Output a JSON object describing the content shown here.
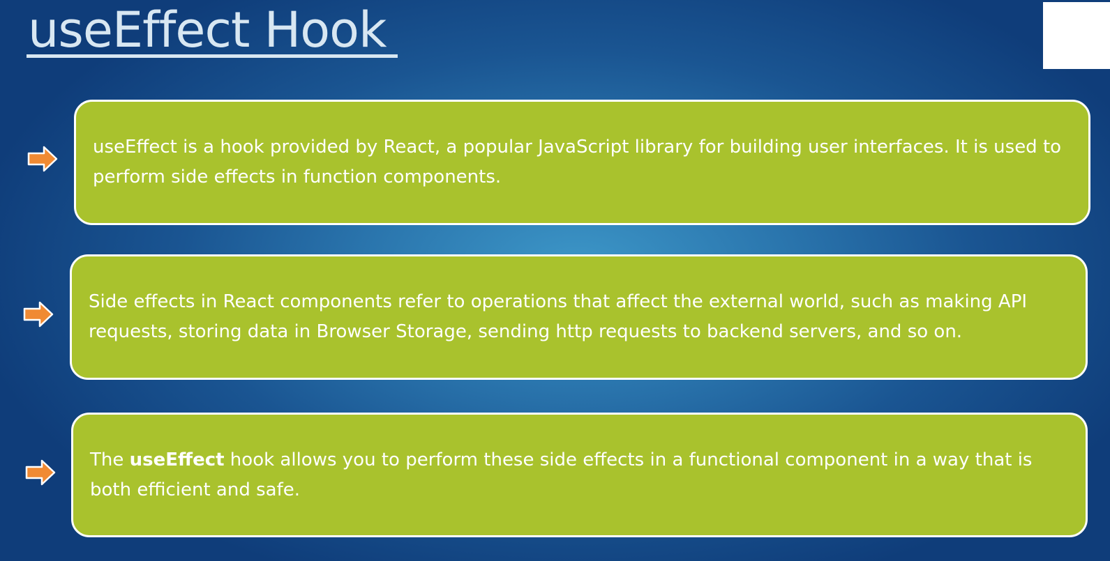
{
  "slide": {
    "title": "useEffect Hook"
  },
  "colors": {
    "card_fill": "#a9c22d",
    "card_border": "#ffffff",
    "arrow": "#f08a33",
    "title": "#d8e7f2",
    "background": "#1a5592"
  },
  "icons": {
    "bullet": "right-arrow-icon"
  },
  "points": [
    {
      "text": "useEffect is a hook provided by React, a popular JavaScript library for building user interfaces. It is used to perform side effects in function components."
    },
    {
      "text": "Side effects in React components refer to operations that affect the external world, such as making API requests, storing data in Browser Storage, sending http requests to backend servers, and so on."
    },
    {
      "prefix": "The ",
      "bold": "useEffect",
      "suffix": " hook allows you to perform these side effects in a functional component in a way that is both efficient and safe."
    }
  ]
}
